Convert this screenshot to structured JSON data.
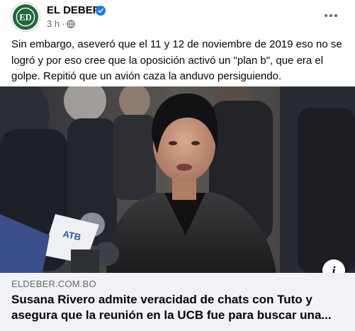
{
  "post": {
    "page_name": "EL DEBER",
    "avatar_text": "ED",
    "time": "3 h",
    "separator": "·",
    "text": "Sin embargo, aseveró que el 11 y 12 de noviembre de 2019 eso no se logró y por eso cree que la oposición activó un \"plan b\", que era el golpe. Repitió que un avión caza la anduvo persiguiendo."
  },
  "link": {
    "domain": "ELDEBER.COM.BO",
    "title": "Susana Rivero admite veracidad de chats con Tuto y asegura que la reunión en la UCB fue para buscar una..."
  },
  "media": {
    "microphone_text": "ATB"
  },
  "icons": {
    "verified": "verified-badge-icon",
    "audience": "globe-icon",
    "more": "more-options-icon",
    "info": "info-icon"
  },
  "colors": {
    "brand_green": "#1f6a3c",
    "verified_blue": "#1877f2",
    "secondary_text": "#65676b",
    "link_background": "#f0f2f5"
  }
}
